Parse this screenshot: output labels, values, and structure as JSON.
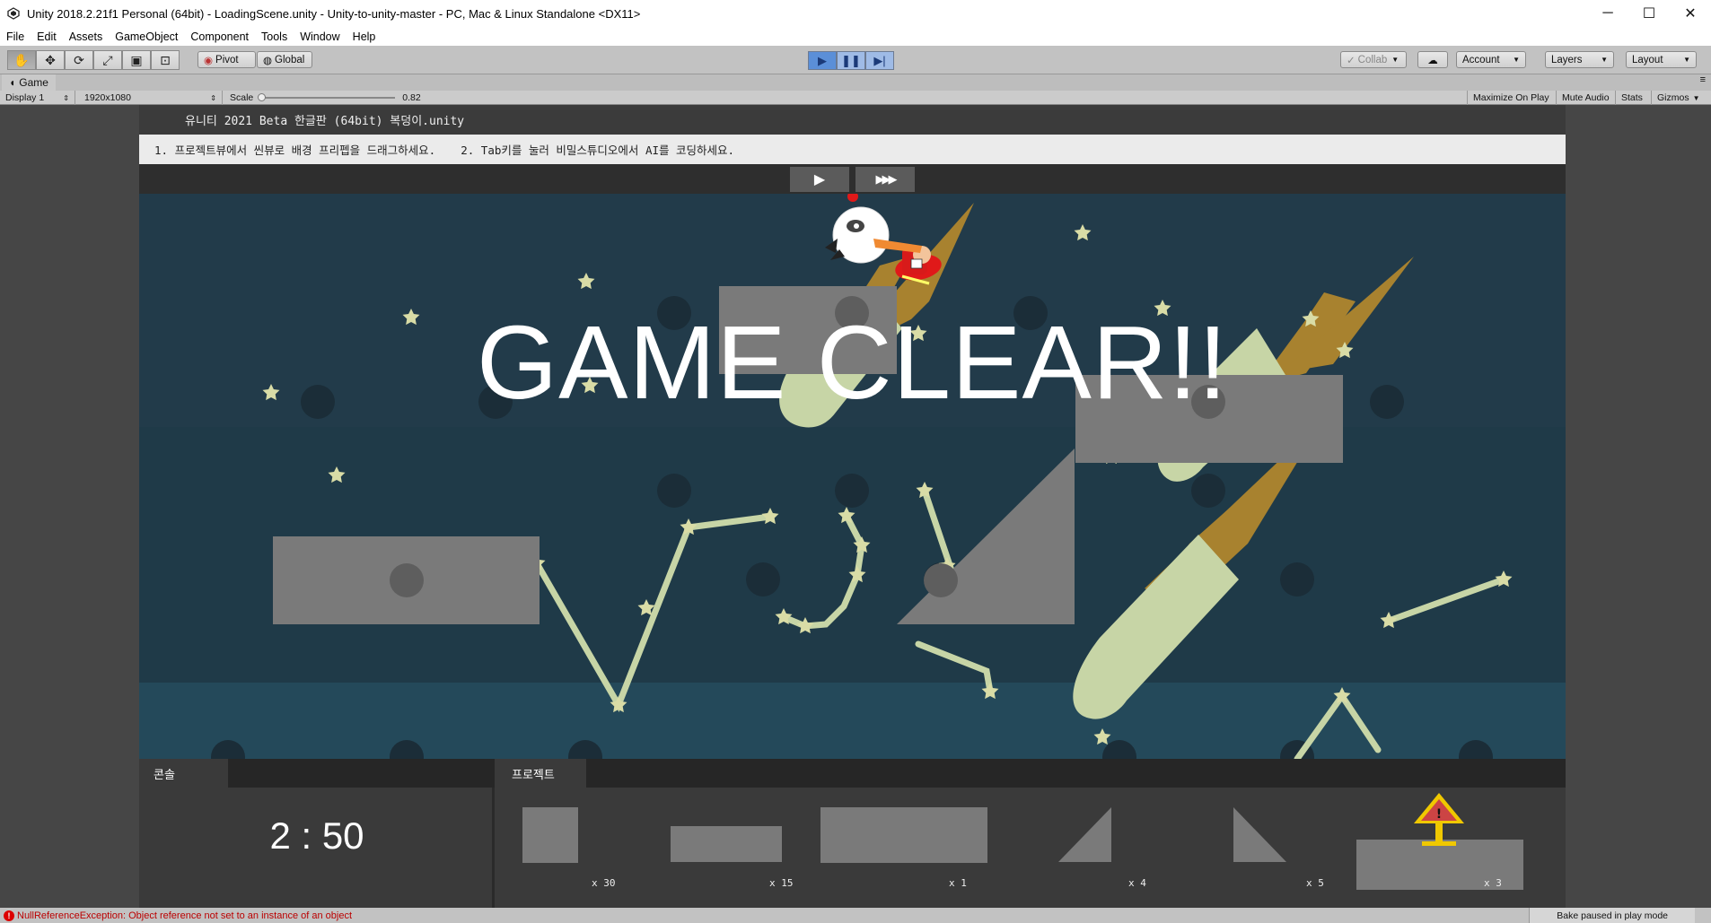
{
  "window": {
    "title": "Unity 2018.2.21f1 Personal (64bit) - LoadingScene.unity - Unity-to-unity-master - PC, Mac & Linux Standalone <DX11>",
    "minimize": "─",
    "maximize": "☐",
    "close": "✕"
  },
  "menu": [
    "File",
    "Edit",
    "Assets",
    "GameObject",
    "Component",
    "Tools",
    "Window",
    "Help"
  ],
  "toolbar": {
    "pivot": "Pivot",
    "global": "Global",
    "collab": "Collab",
    "account": "Account",
    "layers": "Layers",
    "layout": "Layout"
  },
  "game_tab": {
    "label": "Game",
    "display": "Display 1",
    "resolution": "1920x1080",
    "scale_label": "Scale",
    "scale_value": "0.82",
    "maximize_on_play": "Maximize On Play",
    "mute_audio": "Mute Audio",
    "stats": "Stats",
    "gizmos": "Gizmos"
  },
  "game": {
    "header_title": "유니티 2021 Beta 한글판 (64bit) 복덩이.unity",
    "instructions": [
      "1. 프로젝트뷰에서 씬뷰로 배경 프리펩을 드래그하세요.",
      "2. Tab키를 눌러 비밀스튜디오에서 AI를 코딩하세요."
    ],
    "play_symbol": "▶",
    "fast_symbol": "▶▶▶",
    "clear_text": "GAME CLEAR!!",
    "console_label": "콘솔",
    "timer": "2 : 50",
    "project_label": "프로젝트",
    "items": [
      {
        "shape": "square",
        "qty": "x 30"
      },
      {
        "shape": "wide-rect",
        "qty": "x 15"
      },
      {
        "shape": "big-rect",
        "qty": "x 1"
      },
      {
        "shape": "triangle-right",
        "qty": "x 4"
      },
      {
        "shape": "triangle-left",
        "qty": "x 5"
      },
      {
        "shape": "goal-sign",
        "qty": "x 3"
      }
    ]
  },
  "status": {
    "error": "NullReferenceException: Object reference not set to an instance of an object",
    "bake": "Bake paused in play mode"
  },
  "colors": {
    "sky": "#223b4a",
    "platform": "#7a7a7a",
    "star": "#d9dca6",
    "comet": "#c7d5a6",
    "flame": "#a8822f"
  }
}
